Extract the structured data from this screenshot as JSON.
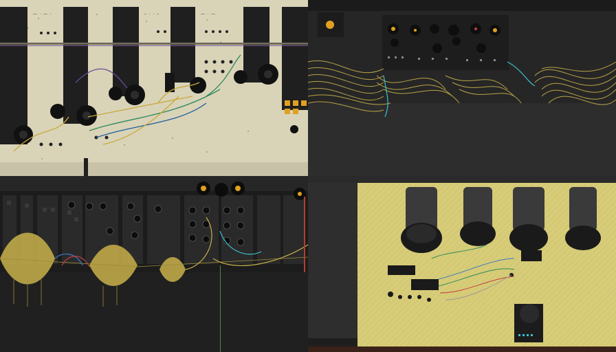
{
  "image": {
    "layout": "2x2 grid of generated images of modular synthesizer patches",
    "panels": [
      {
        "position": "top-left",
        "name": "cream-rack-with-tall-modules"
      },
      {
        "position": "top-right",
        "name": "dark-rack-with-yellow-cables"
      },
      {
        "position": "bottom-left",
        "name": "black-rack-with-gold-waveforms"
      },
      {
        "position": "bottom-right",
        "name": "yellow-rack-with-large-knobs"
      }
    ]
  },
  "colors": {
    "cream": "#d9d3b8",
    "dark": "#202020",
    "gold": "#c9b14a",
    "yellow_panel": "#d7cc78",
    "accent_orange": "#e0a020"
  }
}
